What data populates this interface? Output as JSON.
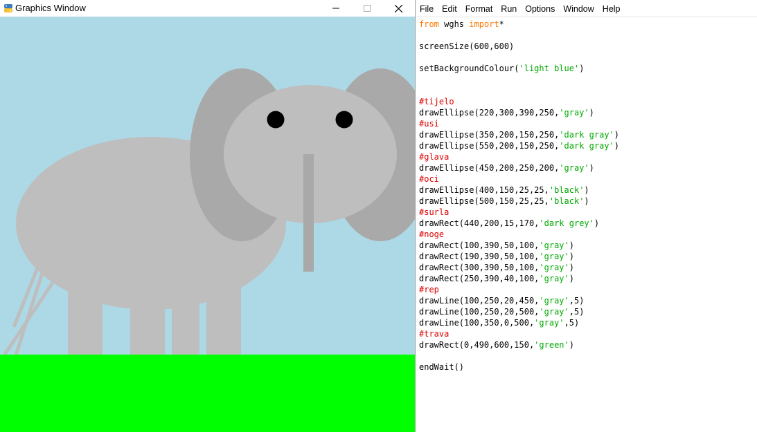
{
  "graphics_window": {
    "title": "Graphics Window",
    "buttons": {
      "minimize": "minimize-icon",
      "maximize": "maximize-icon",
      "close": "close-icon"
    },
    "scene": {
      "background": "#add8e6",
      "layers": [
        {
          "name": "body-ellipse",
          "color": "#bebebe"
        },
        {
          "name": "ear-left-ellipse",
          "color": "#a9a9a9"
        },
        {
          "name": "ear-right-ellipse",
          "color": "#a9a9a9"
        },
        {
          "name": "head-ellipse",
          "color": "#bebebe"
        },
        {
          "name": "eye-left",
          "color": "#000000"
        },
        {
          "name": "eye-right",
          "color": "#000000"
        },
        {
          "name": "trunk-rect",
          "color": "#a9a9a9"
        },
        {
          "name": "leg-1-rect",
          "color": "#bebebe"
        },
        {
          "name": "leg-2-rect",
          "color": "#bebebe"
        },
        {
          "name": "leg-3-rect",
          "color": "#bebebe"
        },
        {
          "name": "leg-4-rect",
          "color": "#bebebe"
        },
        {
          "name": "tail-line-1",
          "color": "#bebebe"
        },
        {
          "name": "tail-line-2",
          "color": "#bebebe"
        },
        {
          "name": "tail-line-3",
          "color": "#bebebe"
        },
        {
          "name": "grass-rect",
          "color": "#00ff00"
        }
      ]
    }
  },
  "editor": {
    "menu": [
      "File",
      "Edit",
      "Format",
      "Run",
      "Options",
      "Window",
      "Help"
    ],
    "colors": {
      "keyword": "#ff7700",
      "string": "#00aa00",
      "comment": "#dd0000",
      "text": "#000000"
    },
    "code_lines": [
      [
        {
          "t": "kw",
          "v": "from"
        },
        {
          "t": "",
          "v": " wghs "
        },
        {
          "t": "kw",
          "v": "import"
        },
        {
          "t": "",
          "v": "*"
        }
      ],
      [],
      [
        {
          "t": "",
          "v": "screenSize(600,600)"
        }
      ],
      [],
      [
        {
          "t": "",
          "v": "setBackgroundColour("
        },
        {
          "t": "str",
          "v": "'light blue'"
        },
        {
          "t": "",
          "v": ")"
        }
      ],
      [],
      [],
      [
        {
          "t": "cmt",
          "v": "#tijelo"
        }
      ],
      [
        {
          "t": "",
          "v": "drawEllipse(220,300,390,250,"
        },
        {
          "t": "str",
          "v": "'gray'"
        },
        {
          "t": "",
          "v": ")"
        }
      ],
      [
        {
          "t": "cmt",
          "v": "#usi"
        }
      ],
      [
        {
          "t": "",
          "v": "drawEllipse(350,200,150,250,"
        },
        {
          "t": "str",
          "v": "'dark gray'"
        },
        {
          "t": "",
          "v": ")"
        }
      ],
      [
        {
          "t": "",
          "v": "drawEllipse(550,200,150,250,"
        },
        {
          "t": "str",
          "v": "'dark gray'"
        },
        {
          "t": "",
          "v": ")"
        }
      ],
      [
        {
          "t": "cmt",
          "v": "#glava"
        }
      ],
      [
        {
          "t": "",
          "v": "drawEllipse(450,200,250,200,"
        },
        {
          "t": "str",
          "v": "'gray'"
        },
        {
          "t": "",
          "v": ")"
        }
      ],
      [
        {
          "t": "cmt",
          "v": "#oci"
        }
      ],
      [
        {
          "t": "",
          "v": "drawEllipse(400,150,25,25,"
        },
        {
          "t": "str",
          "v": "'black'"
        },
        {
          "t": "",
          "v": ")"
        }
      ],
      [
        {
          "t": "",
          "v": "drawEllipse(500,150,25,25,"
        },
        {
          "t": "str",
          "v": "'black'"
        },
        {
          "t": "",
          "v": ")"
        }
      ],
      [
        {
          "t": "cmt",
          "v": "#surla"
        }
      ],
      [
        {
          "t": "",
          "v": "drawRect(440,200,15,170,"
        },
        {
          "t": "str",
          "v": "'dark grey'"
        },
        {
          "t": "",
          "v": ")"
        }
      ],
      [
        {
          "t": "cmt",
          "v": "#noge"
        }
      ],
      [
        {
          "t": "",
          "v": "drawRect(100,390,50,100,"
        },
        {
          "t": "str",
          "v": "'gray'"
        },
        {
          "t": "",
          "v": ")"
        }
      ],
      [
        {
          "t": "",
          "v": "drawRect(190,390,50,100,"
        },
        {
          "t": "str",
          "v": "'gray'"
        },
        {
          "t": "",
          "v": ")"
        }
      ],
      [
        {
          "t": "",
          "v": "drawRect(300,390,50,100,"
        },
        {
          "t": "str",
          "v": "'gray'"
        },
        {
          "t": "",
          "v": ")"
        }
      ],
      [
        {
          "t": "",
          "v": "drawRect(250,390,40,100,"
        },
        {
          "t": "str",
          "v": "'gray'"
        },
        {
          "t": "",
          "v": ")"
        }
      ],
      [
        {
          "t": "cmt",
          "v": "#rep"
        }
      ],
      [
        {
          "t": "",
          "v": "drawLine(100,250,20,450,"
        },
        {
          "t": "str",
          "v": "'gray'"
        },
        {
          "t": "",
          "v": ",5)"
        }
      ],
      [
        {
          "t": "",
          "v": "drawLine(100,250,20,500,"
        },
        {
          "t": "str",
          "v": "'gray'"
        },
        {
          "t": "",
          "v": ",5)"
        }
      ],
      [
        {
          "t": "",
          "v": "drawLine(100,350,0,500,"
        },
        {
          "t": "str",
          "v": "'gray'"
        },
        {
          "t": "",
          "v": ",5)"
        }
      ],
      [
        {
          "t": "cmt",
          "v": "#trava"
        }
      ],
      [
        {
          "t": "",
          "v": "drawRect(0,490,600,150,"
        },
        {
          "t": "str",
          "v": "'green'"
        },
        {
          "t": "",
          "v": ")"
        }
      ],
      [],
      [
        {
          "t": "",
          "v": "endWait()"
        }
      ]
    ]
  }
}
